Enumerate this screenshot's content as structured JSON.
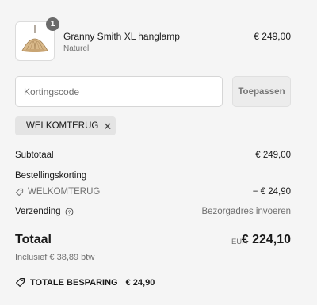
{
  "product": {
    "quantity": "1",
    "name": "Granny Smith XL hanglamp",
    "variant": "Naturel",
    "price": "€ 249,00"
  },
  "discount": {
    "placeholder": "Kortingscode",
    "apply_label": "Toepassen",
    "applied_code": "WELKOMTERUG"
  },
  "summary": {
    "subtotal_label": "Subtotaal",
    "subtotal_value": "€ 249,00",
    "order_discount_label": "Bestellingskorting",
    "order_discount_code": "WELKOMTERUG",
    "order_discount_value": "− € 24,90",
    "shipping_label": "Verzending",
    "shipping_value": "Bezorgadres invoeren",
    "total_label": "Totaal",
    "total_currency": "EUR",
    "total_value": "€ 224,10",
    "tax_note": "Inclusief € 38,89 btw",
    "savings_label": "TOTALE BESPARING",
    "savings_value": "€ 24,90"
  },
  "icons": {
    "tag": "tag-icon",
    "close": "close-icon",
    "info": "info-icon",
    "product_image": "pendant-lamp-image"
  }
}
